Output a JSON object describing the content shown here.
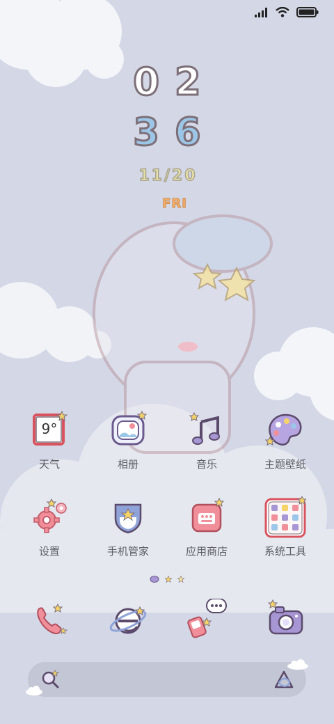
{
  "clock": {
    "hour": "02",
    "minute": "36",
    "date": "11/20",
    "weekday": "FRI"
  },
  "apps_row1": [
    {
      "label": "天气",
      "icon": "weather-icon",
      "value": "9°"
    },
    {
      "label": "相册",
      "icon": "gallery-icon"
    },
    {
      "label": "音乐",
      "icon": "music-icon"
    },
    {
      "label": "主题壁纸",
      "icon": "palette-icon"
    }
  ],
  "apps_row2": [
    {
      "label": "设置",
      "icon": "gear-icon"
    },
    {
      "label": "手机管家",
      "icon": "shield-icon"
    },
    {
      "label": "应用商店",
      "icon": "app-store-icon"
    },
    {
      "label": "系统工具",
      "icon": "tools-folder-icon"
    }
  ],
  "dock": [
    {
      "icon": "phone-icon"
    },
    {
      "icon": "browser-icon"
    },
    {
      "icon": "messages-icon"
    },
    {
      "icon": "camera-icon"
    }
  ],
  "colors": {
    "background": "#d3d7e6",
    "outline": "#7d6f78",
    "pink": "#f08f9a",
    "blue": "#9cc6e8",
    "purple": "#a796d4",
    "yellow": "#f6d46a"
  }
}
